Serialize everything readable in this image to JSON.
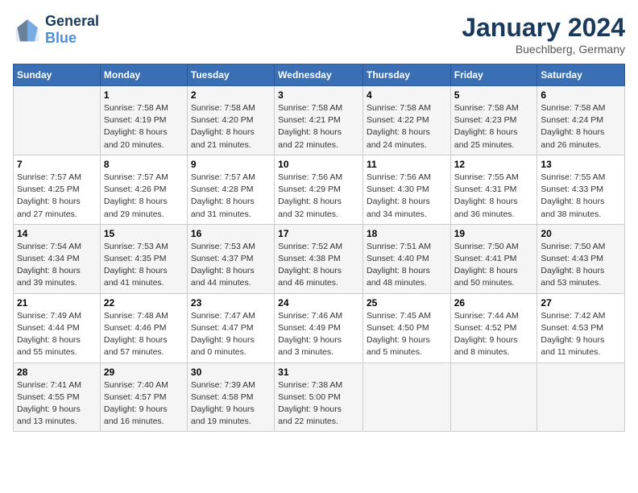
{
  "logo": {
    "line1": "General",
    "line2": "Blue"
  },
  "title": "January 2024",
  "location": "Buechlberg, Germany",
  "days_header": [
    "Sunday",
    "Monday",
    "Tuesday",
    "Wednesday",
    "Thursday",
    "Friday",
    "Saturday"
  ],
  "weeks": [
    [
      {
        "day": "",
        "info": ""
      },
      {
        "day": "1",
        "info": "Sunrise: 7:58 AM\nSunset: 4:19 PM\nDaylight: 8 hours\nand 20 minutes."
      },
      {
        "day": "2",
        "info": "Sunrise: 7:58 AM\nSunset: 4:20 PM\nDaylight: 8 hours\nand 21 minutes."
      },
      {
        "day": "3",
        "info": "Sunrise: 7:58 AM\nSunset: 4:21 PM\nDaylight: 8 hours\nand 22 minutes."
      },
      {
        "day": "4",
        "info": "Sunrise: 7:58 AM\nSunset: 4:22 PM\nDaylight: 8 hours\nand 24 minutes."
      },
      {
        "day": "5",
        "info": "Sunrise: 7:58 AM\nSunset: 4:23 PM\nDaylight: 8 hours\nand 25 minutes."
      },
      {
        "day": "6",
        "info": "Sunrise: 7:58 AM\nSunset: 4:24 PM\nDaylight: 8 hours\nand 26 minutes."
      }
    ],
    [
      {
        "day": "7",
        "info": "Sunrise: 7:57 AM\nSunset: 4:25 PM\nDaylight: 8 hours\nand 27 minutes."
      },
      {
        "day": "8",
        "info": "Sunrise: 7:57 AM\nSunset: 4:26 PM\nDaylight: 8 hours\nand 29 minutes."
      },
      {
        "day": "9",
        "info": "Sunrise: 7:57 AM\nSunset: 4:28 PM\nDaylight: 8 hours\nand 31 minutes."
      },
      {
        "day": "10",
        "info": "Sunrise: 7:56 AM\nSunset: 4:29 PM\nDaylight: 8 hours\nand 32 minutes."
      },
      {
        "day": "11",
        "info": "Sunrise: 7:56 AM\nSunset: 4:30 PM\nDaylight: 8 hours\nand 34 minutes."
      },
      {
        "day": "12",
        "info": "Sunrise: 7:55 AM\nSunset: 4:31 PM\nDaylight: 8 hours\nand 36 minutes."
      },
      {
        "day": "13",
        "info": "Sunrise: 7:55 AM\nSunset: 4:33 PM\nDaylight: 8 hours\nand 38 minutes."
      }
    ],
    [
      {
        "day": "14",
        "info": "Sunrise: 7:54 AM\nSunset: 4:34 PM\nDaylight: 8 hours\nand 39 minutes."
      },
      {
        "day": "15",
        "info": "Sunrise: 7:53 AM\nSunset: 4:35 PM\nDaylight: 8 hours\nand 41 minutes."
      },
      {
        "day": "16",
        "info": "Sunrise: 7:53 AM\nSunset: 4:37 PM\nDaylight: 8 hours\nand 44 minutes."
      },
      {
        "day": "17",
        "info": "Sunrise: 7:52 AM\nSunset: 4:38 PM\nDaylight: 8 hours\nand 46 minutes."
      },
      {
        "day": "18",
        "info": "Sunrise: 7:51 AM\nSunset: 4:40 PM\nDaylight: 8 hours\nand 48 minutes."
      },
      {
        "day": "19",
        "info": "Sunrise: 7:50 AM\nSunset: 4:41 PM\nDaylight: 8 hours\nand 50 minutes."
      },
      {
        "day": "20",
        "info": "Sunrise: 7:50 AM\nSunset: 4:43 PM\nDaylight: 8 hours\nand 53 minutes."
      }
    ],
    [
      {
        "day": "21",
        "info": "Sunrise: 7:49 AM\nSunset: 4:44 PM\nDaylight: 8 hours\nand 55 minutes."
      },
      {
        "day": "22",
        "info": "Sunrise: 7:48 AM\nSunset: 4:46 PM\nDaylight: 8 hours\nand 57 minutes."
      },
      {
        "day": "23",
        "info": "Sunrise: 7:47 AM\nSunset: 4:47 PM\nDaylight: 9 hours\nand 0 minutes."
      },
      {
        "day": "24",
        "info": "Sunrise: 7:46 AM\nSunset: 4:49 PM\nDaylight: 9 hours\nand 3 minutes."
      },
      {
        "day": "25",
        "info": "Sunrise: 7:45 AM\nSunset: 4:50 PM\nDaylight: 9 hours\nand 5 minutes."
      },
      {
        "day": "26",
        "info": "Sunrise: 7:44 AM\nSunset: 4:52 PM\nDaylight: 9 hours\nand 8 minutes."
      },
      {
        "day": "27",
        "info": "Sunrise: 7:42 AM\nSunset: 4:53 PM\nDaylight: 9 hours\nand 11 minutes."
      }
    ],
    [
      {
        "day": "28",
        "info": "Sunrise: 7:41 AM\nSunset: 4:55 PM\nDaylight: 9 hours\nand 13 minutes."
      },
      {
        "day": "29",
        "info": "Sunrise: 7:40 AM\nSunset: 4:57 PM\nDaylight: 9 hours\nand 16 minutes."
      },
      {
        "day": "30",
        "info": "Sunrise: 7:39 AM\nSunset: 4:58 PM\nDaylight: 9 hours\nand 19 minutes."
      },
      {
        "day": "31",
        "info": "Sunrise: 7:38 AM\nSunset: 5:00 PM\nDaylight: 9 hours\nand 22 minutes."
      },
      {
        "day": "",
        "info": ""
      },
      {
        "day": "",
        "info": ""
      },
      {
        "day": "",
        "info": ""
      }
    ]
  ]
}
